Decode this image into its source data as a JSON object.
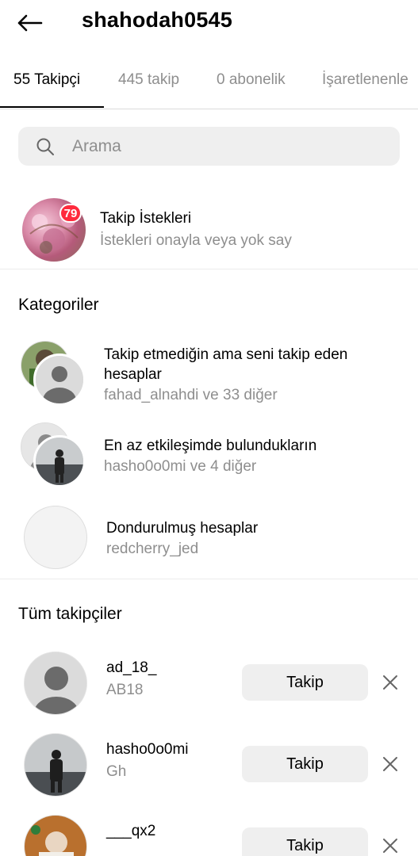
{
  "header": {
    "title": "shahodah0545"
  },
  "tabs": [
    {
      "label": "55 Takipçi",
      "active": true
    },
    {
      "label": "445 takip",
      "active": false
    },
    {
      "label": "0 abonelik",
      "active": false
    },
    {
      "label": "İşaretlenenle",
      "active": false
    }
  ],
  "search": {
    "placeholder": "Arama"
  },
  "requests": {
    "badge": "79",
    "title": "Takip İstekleri",
    "subtitle": "İstekleri onayla veya yok say"
  },
  "categories": {
    "heading": "Kategoriler",
    "items": [
      {
        "title": "Takip etmediğin ama seni takip eden hesaplar",
        "subtitle": "fahad_alnahdi ve 33 diğer"
      },
      {
        "title": "En az etkileşimde bulundukların",
        "subtitle": "hasho0o0mi ve 4 diğer"
      },
      {
        "title": "Dondurulmuş hesaplar",
        "subtitle": "redcherry_jed"
      }
    ]
  },
  "all_followers": {
    "heading": "Tüm takipçiler",
    "items": [
      {
        "username": "ad_18_",
        "name": "AB18",
        "button": "Takip"
      },
      {
        "username": "hasho0o0mi",
        "name": "Gh",
        "button": "Takip"
      },
      {
        "username": "___qx2",
        "name": "",
        "button": "Takip"
      }
    ]
  },
  "colors": {
    "badge": "#ff2a3d",
    "secondary_text": "#8e8e8e",
    "button_bg": "#efefef"
  }
}
